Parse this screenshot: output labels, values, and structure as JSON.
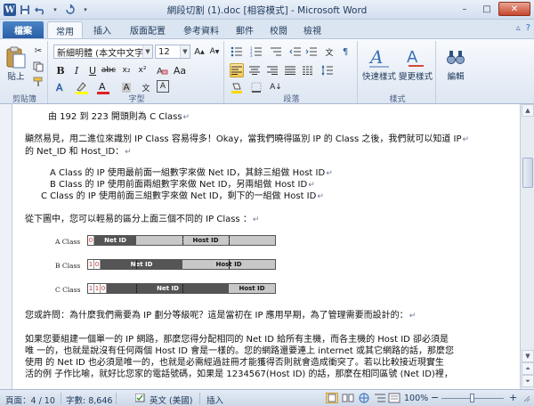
{
  "titlebar": {
    "title": "網段切割 (1).doc [相容模式] - Microsoft Word",
    "min": "–",
    "max": "□",
    "close": "✕"
  },
  "tabs": [
    {
      "label": "檔案"
    },
    {
      "label": "常用"
    },
    {
      "label": "插入"
    },
    {
      "label": "版面配置"
    },
    {
      "label": "參考資料"
    },
    {
      "label": "郵件"
    },
    {
      "label": "校閱"
    },
    {
      "label": "檢視"
    }
  ],
  "ribbon": {
    "clipboard": {
      "paste": "貼上",
      "label": "剪貼簿"
    },
    "font": {
      "name": "新細明體 (本文中文字",
      "size": "12",
      "label": "字型"
    },
    "paragraph": {
      "label": "段落"
    },
    "styles": {
      "quick": "快速樣式",
      "change": "變更樣式",
      "label": "樣式"
    },
    "editing": {
      "edit": "編輯"
    }
  },
  "document": {
    "lines": [
      "由 192 到 223 開頭則為 C Class",
      "顯然易見，用二進位來識別 IP Class 容易得多！Okay，當我們曉得區別 IP 的 Class 之後，我們就可以知道 IP",
      "的  Net_ID 和 Host_ID：",
      "A Class 的 IP 使用最前面一組數字來做 Net ID，其餘三組做 Host ID",
      "B Class 的 IP 使用前面兩組數字來做 Net ID，另兩組做 Host ID",
      "C Class 的 IP 使用前面三組數字來做  Net ID，剩下的一組做  Host ID",
      "從下圖中，您可以輕易的區分上面三個不同的  IP  Class  ：",
      "您或許問：為什麼我們需要為  IP 劃分等級呢？這是當初在  IP 應用早期，為了管理需要而設計的：",
      "如果您要組建一個單一的 IP 網路，那麼您得分配相同的  Net ID 給所有主機，而各主機的 Host ID 卻必須是",
      "唯 一的，也就是說沒有任何兩個  Host ID 會是一樣的。您的網路還要連上 internet 或其它網路的話，那麼您",
      "使用  的  Net ID 也必須是唯一的，也就是必需經過註冊才能獲得否則就會造成衝突了。若以比較接近現實生",
      "活的例  子作比喻，就好比您家的電話號碼，如果是  1234567(Host ID) 的話，那麼在相同區號  (Net ID)裡，"
    ],
    "figure": {
      "a_label": "A Class",
      "b_label": "B Class",
      "c_label": "C Class",
      "net_id": "Net ID",
      "host_id": "Host ID",
      "bit0": "0",
      "bit1": "1"
    }
  },
  "statusbar": {
    "page": "頁面：4 / 10",
    "words": "字數: 8,646",
    "lang": "英文 (美國)",
    "mode": "插入",
    "zoom": "100%",
    "zoom_out": "−",
    "zoom_in": "+"
  }
}
